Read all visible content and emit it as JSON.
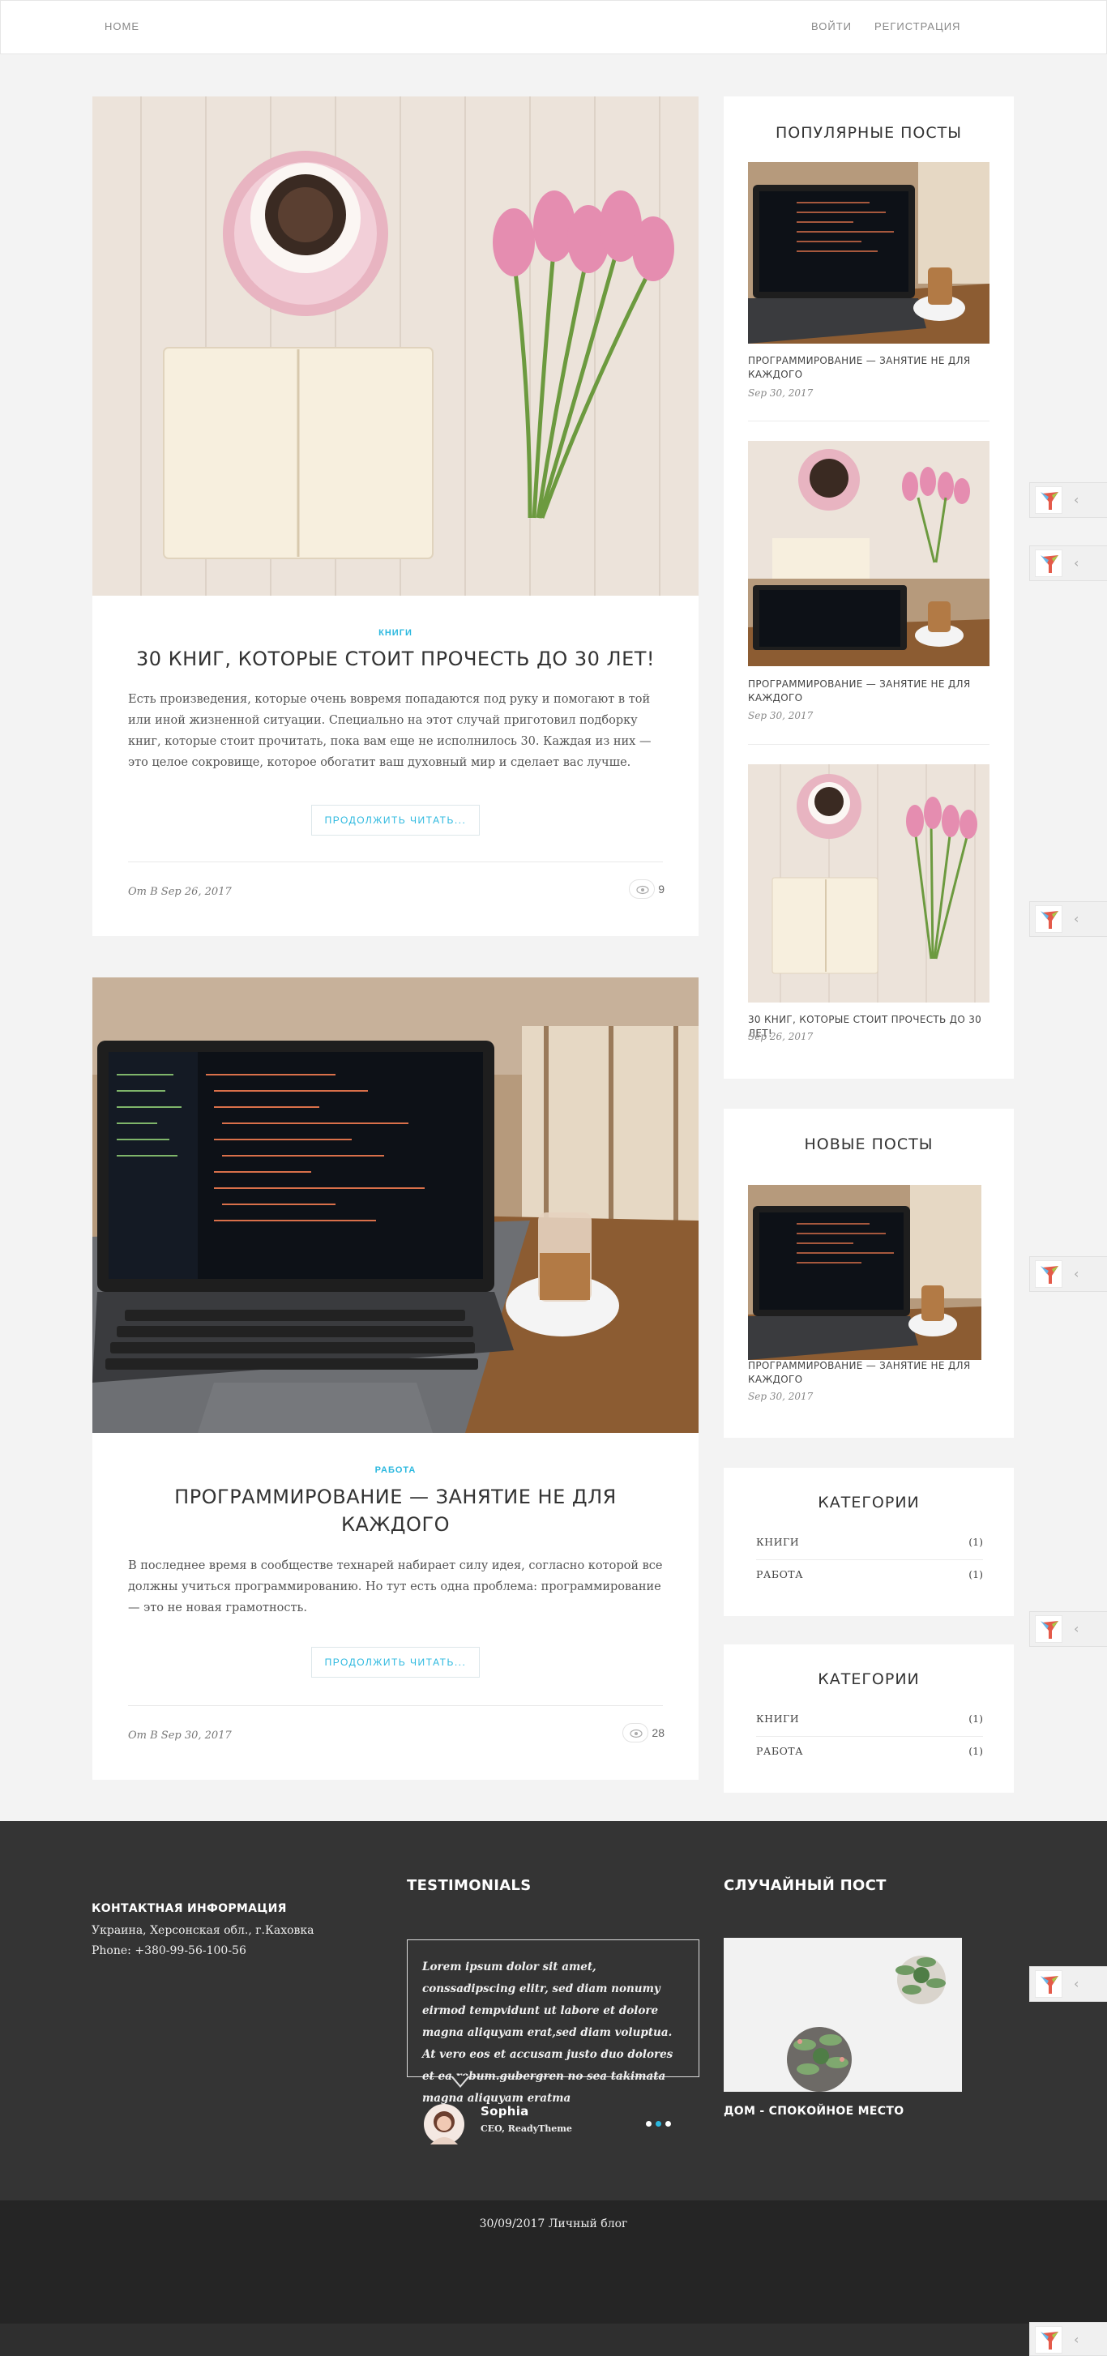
{
  "nav": {
    "home": "HOME",
    "login": "ВОЙТИ",
    "register": "РЕГИСТРАЦИЯ"
  },
  "posts": [
    {
      "category": "КНИГИ",
      "title": "30 КНИГ, КОТОРЫЕ СТОИТ ПРОЧЕСТЬ ДО 30 ЛЕТ!",
      "excerpt": "Есть произведения, которые очень вовремя попадаются под руку и помогают в той или иной жизненной ситуации. Специально на этот случай приготовил подборку книг, которые стоит прочитать, пока вам еще не исполнилось 30. Каждая из них — это целое сокровище, которое обогатит ваш духовный мир и сделает вас лучше.",
      "read_more": "ПРОДОЛЖИТЬ ЧИТАТЬ...",
      "meta": "От  В Sep 26, 2017",
      "views": "9"
    },
    {
      "category": "РАБОТА",
      "title": "ПРОГРАММИРОВАНИЕ — ЗАНЯТИЕ НЕ ДЛЯ КАЖДОГО",
      "excerpt": "В последнее время в сообществе технарей набирает силу идея, согласно которой все должны учиться программированию. Но тут есть одна проблема: программирование — это не новая грамотность.",
      "read_more": "ПРОДОЛЖИТЬ ЧИТАТЬ...",
      "meta": "От  В Sep 30, 2017",
      "views": "28"
    }
  ],
  "sidebar": {
    "popular": {
      "title": "ПОПУЛЯРНЫЕ ПОСТЫ",
      "items": [
        {
          "title": "ПРОГРАММИРОВАНИЕ — ЗАНЯТИЕ НЕ ДЛЯ КАЖДОГО",
          "date": "Sep 30, 2017"
        },
        {
          "title": "ПРОГРАММИРОВАНИЕ — ЗАНЯТИЕ НЕ ДЛЯ КАЖДОГО",
          "date": "Sep 30, 2017"
        },
        {
          "title": "30 КНИГ, КОТОРЫЕ СТОИТ ПРОЧЕСТЬ ДО 30 ЛЕТ!",
          "date": "Sep 26, 2017"
        }
      ]
    },
    "new_posts": {
      "title": "НОВЫЕ ПОСТЫ",
      "items": [
        {
          "title": "ПРОГРАММИРОВАНИЕ — ЗАНЯТИЕ НЕ ДЛЯ КАЖДОГО",
          "date": "Sep 30, 2017"
        }
      ]
    },
    "categories": [
      {
        "title": "КАТЕГОРИИ",
        "items": [
          {
            "label": "КНИГИ",
            "count": "(1)"
          },
          {
            "label": "РАБОТА",
            "count": "(1)"
          }
        ]
      },
      {
        "title": "КАТЕГОРИИ",
        "items": [
          {
            "label": "КНИГИ",
            "count": "(1)"
          },
          {
            "label": "РАБОТА",
            "count": "(1)"
          }
        ]
      }
    ]
  },
  "footer": {
    "contact_title": "КОНТАКТНАЯ ИНФОРМАЦИЯ",
    "address": "Украина, Херсонская обл., г.Каховка",
    "phone": "Phone: +380-99-56-100-56",
    "testimonials_title": "TESTIMONIALS",
    "testimonial_text": "Lorem ipsum dolor sit amet, conssadipscing elitr, sed diam nonumy eirmod tempvidunt ut labore et dolore magna aliquyam erat,sed diam voluptua. At vero eos et accusam justo duo dolores et ea rebum.gubergren no sea takimata magna aliquyam eratma",
    "author_name": "Sophia",
    "author_role": "CEO, ReadyTheme",
    "random_title": "СЛУЧАЙНЫЙ ПОСТ",
    "random_post_title": "ДОМ - СПОКОЙНОЕ МЕСТО",
    "copyright": "30/09/2017 Личный блог"
  },
  "colors": {
    "accent": "#2bb8df",
    "footer_bg": "#343434",
    "subfooter_bg": "#252525",
    "page_bg": "#f3f3f3"
  }
}
